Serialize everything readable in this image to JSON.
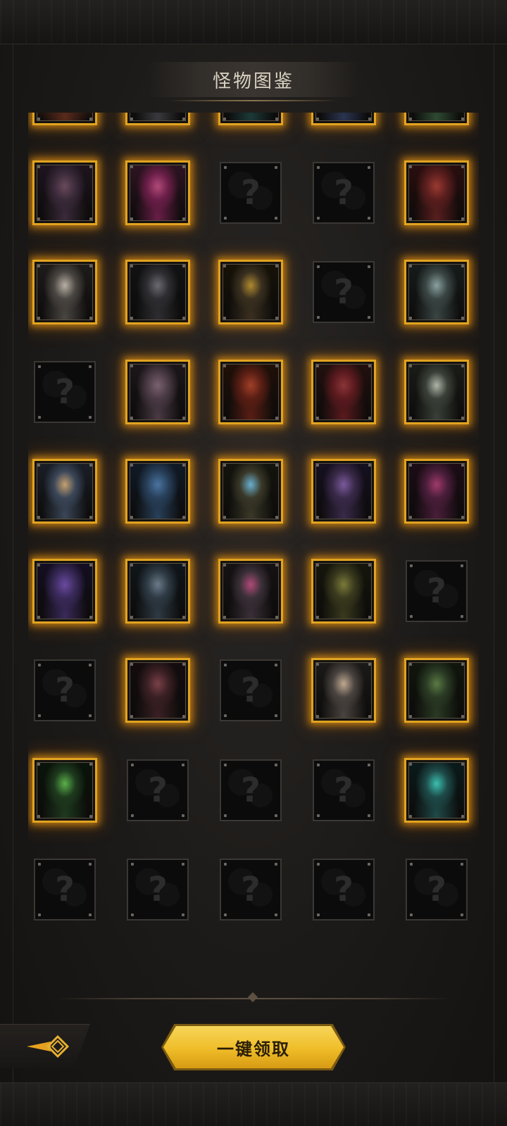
{
  "header": {
    "title": "怪物图鉴"
  },
  "grid": {
    "columns": 5,
    "rows": [
      [
        {
          "state": "unlocked",
          "monster": "horned-red-demon",
          "colors": [
            "#5a2a1c",
            "#8a4428",
            "#2a1610"
          ]
        },
        {
          "state": "unlocked",
          "monster": "armored-hooded-knight",
          "colors": [
            "#3a3a3e",
            "#1e1e22",
            "#5c5c60"
          ]
        },
        {
          "state": "unlocked",
          "monster": "green-eyed-wraith",
          "colors": [
            "#1c3a38",
            "#0f1f1e",
            "#3a7a6a"
          ]
        },
        {
          "state": "unlocked",
          "monster": "armored-beast-warrior",
          "colors": [
            "#2a3550",
            "#1a1e2c",
            "#5a6a8a"
          ]
        },
        {
          "state": "unlocked",
          "monster": "green-goblin-orc",
          "colors": [
            "#2f4a32",
            "#1a241a",
            "#5e7a4a"
          ]
        }
      ],
      [
        {
          "state": "unlocked",
          "monster": "pale-ghoul",
          "colors": [
            "#3a2a3a",
            "#1e141e",
            "#6a4a5a"
          ]
        },
        {
          "state": "unlocked",
          "monster": "pink-haired-woman",
          "colors": [
            "#6a1e48",
            "#2e1422",
            "#b04a78"
          ]
        },
        {
          "state": "locked"
        },
        {
          "state": "locked"
        },
        {
          "state": "unlocked",
          "monster": "red-fanged-beast",
          "colors": [
            "#5a1e1e",
            "#2a0e0e",
            "#9a3a30"
          ]
        }
      ],
      [
        {
          "state": "unlocked",
          "monster": "white-hooded-assassin",
          "colors": [
            "#4a4642",
            "#1e1c1a",
            "#b8b0a4"
          ]
        },
        {
          "state": "unlocked",
          "monster": "spiked-helm-knight",
          "colors": [
            "#2e2e32",
            "#121214",
            "#6a6a70"
          ]
        },
        {
          "state": "unlocked",
          "monster": "golden-crowned-lich",
          "colors": [
            "#3a3020",
            "#161208",
            "#b08a30"
          ]
        },
        {
          "state": "locked"
        },
        {
          "state": "unlocked",
          "monster": "pale-hooded-ghost",
          "colors": [
            "#3a4644",
            "#161c1b",
            "#8aa0a0"
          ]
        }
      ],
      [
        {
          "state": "locked"
        },
        {
          "state": "unlocked",
          "monster": "scaled-cocoon",
          "colors": [
            "#4a3a44",
            "#1c161a",
            "#7a6070"
          ]
        },
        {
          "state": "unlocked",
          "monster": "red-haired-sorceress",
          "colors": [
            "#5a1e14",
            "#201008",
            "#a04028"
          ]
        },
        {
          "state": "unlocked",
          "monster": "red-hooded-rogue",
          "colors": [
            "#5a1a1e",
            "#22100e",
            "#8a3438"
          ]
        },
        {
          "state": "unlocked",
          "monster": "silver-haired-youth",
          "colors": [
            "#3a4038",
            "#1a1c18",
            "#b0b4a8"
          ]
        }
      ],
      [
        {
          "state": "unlocked",
          "monster": "blonde-hooded-mage",
          "colors": [
            "#3a4658",
            "#1a1e26",
            "#c4a070"
          ]
        },
        {
          "state": "unlocked",
          "monster": "blue-cyclops-ogre",
          "colors": [
            "#28405a",
            "#101a26",
            "#4a74a0"
          ]
        },
        {
          "state": "unlocked",
          "monster": "glowing-shield-guardian",
          "colors": [
            "#3a3828",
            "#14140e",
            "#6ab0d0"
          ]
        },
        {
          "state": "unlocked",
          "monster": "purple-medusa-queen",
          "colors": [
            "#3a2a4a",
            "#161020",
            "#7a5a9a"
          ]
        },
        {
          "state": "unlocked",
          "monster": "crimson-winged-demon",
          "colors": [
            "#4a1e3a",
            "#1c0c16",
            "#a03a6a"
          ]
        }
      ],
      [
        {
          "state": "unlocked",
          "monster": "purple-shadow-beast",
          "colors": [
            "#3a2a5a",
            "#140e22",
            "#6a4aa0"
          ]
        },
        {
          "state": "unlocked",
          "monster": "frost-maned-lion",
          "colors": [
            "#2e3a44",
            "#10161a",
            "#6a7a88"
          ]
        },
        {
          "state": "unlocked",
          "monster": "pink-crested-troll",
          "colors": [
            "#3a3038",
            "#161214",
            "#b04a78"
          ]
        },
        {
          "state": "unlocked",
          "monster": "green-swamp-lizard",
          "colors": [
            "#3a3a1e",
            "#16160c",
            "#7a7a3a"
          ]
        },
        {
          "state": "locked"
        }
      ],
      [
        {
          "state": "locked"
        },
        {
          "state": "unlocked",
          "monster": "horned-vampire-lord",
          "colors": [
            "#3a2024",
            "#140c0e",
            "#7a4048"
          ]
        },
        {
          "state": "locked"
        },
        {
          "state": "unlocked",
          "monster": "winged-helm-valkyrie",
          "colors": [
            "#4a4440",
            "#1c1a18",
            "#c0a890"
          ]
        },
        {
          "state": "unlocked",
          "monster": "green-crocodile-brute",
          "colors": [
            "#2a3a24",
            "#10160c",
            "#5a7a44"
          ]
        }
      ],
      [
        {
          "state": "unlocked",
          "monster": "green-venom-wasp",
          "colors": [
            "#1e3a1e",
            "#0a140a",
            "#5ab04a"
          ]
        },
        {
          "state": "locked"
        },
        {
          "state": "locked"
        },
        {
          "state": "locked"
        },
        {
          "state": "unlocked",
          "monster": "teal-hooded-specter",
          "colors": [
            "#1e4a48",
            "#0a1a1a",
            "#3ac0b0"
          ]
        }
      ],
      [
        {
          "state": "locked"
        },
        {
          "state": "locked"
        },
        {
          "state": "locked"
        },
        {
          "state": "locked"
        },
        {
          "state": "locked"
        }
      ]
    ],
    "locked_symbol": "?"
  },
  "footer": {
    "back_icon": "back-arrow-diamond-icon",
    "claim_label": "一键领取"
  },
  "colors": {
    "accent_gold": "#e1a320",
    "button_gold": "#efbd28",
    "title_text": "#d9d2c4"
  }
}
